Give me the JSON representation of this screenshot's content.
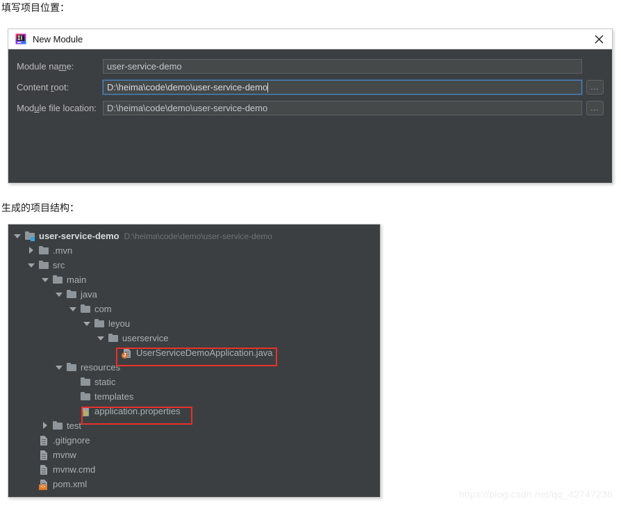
{
  "page": {
    "caption_location": "填写项目位置：",
    "caption_structure": "生成的项目结构：",
    "watermark": "https://blog.csdn.net/qq_42747236"
  },
  "dialog": {
    "title": "New Module",
    "title_icon": "intellij-idea-icon",
    "close_icon": "close-icon",
    "fields": [
      {
        "label_pre": "Module na",
        "label_mnemonic": "m",
        "label_post": "e:",
        "label_full": "Module name:",
        "value": "user-service-demo",
        "focused": false,
        "has_browse": false,
        "browse_label": "..."
      },
      {
        "label_pre": "Content ",
        "label_mnemonic": "r",
        "label_post": "oot:",
        "label_full": "Content root:",
        "value": "D:\\heima\\code\\demo\\user-service-demo",
        "focused": true,
        "has_browse": true,
        "browse_label": "..."
      },
      {
        "label_pre": "Mod",
        "label_mnemonic": "u",
        "label_post": "le file location:",
        "label_full": "Module file location:",
        "value": "D:\\heima\\code\\demo\\user-service-demo",
        "focused": false,
        "has_browse": true,
        "browse_label": "..."
      }
    ]
  },
  "tree": {
    "nodes": [
      {
        "label": "user-service-demo",
        "path": "D:\\heima\\code\\demo\\user-service-demo",
        "depth": 0,
        "twisty": "expanded",
        "icon": "folder-module-icon",
        "root": true,
        "highlighted": false
      },
      {
        "label": ".mvn",
        "path": "",
        "depth": 1,
        "twisty": "collapsed",
        "icon": "folder-icon",
        "root": false,
        "highlighted": false
      },
      {
        "label": "src",
        "path": "",
        "depth": 1,
        "twisty": "expanded",
        "icon": "folder-icon",
        "root": false,
        "highlighted": false
      },
      {
        "label": "main",
        "path": "",
        "depth": 2,
        "twisty": "expanded",
        "icon": "folder-icon",
        "root": false,
        "highlighted": false
      },
      {
        "label": "java",
        "path": "",
        "depth": 3,
        "twisty": "expanded",
        "icon": "folder-icon",
        "root": false,
        "highlighted": false
      },
      {
        "label": "com",
        "path": "",
        "depth": 4,
        "twisty": "expanded",
        "icon": "folder-icon",
        "root": false,
        "highlighted": false
      },
      {
        "label": "leyou",
        "path": "",
        "depth": 5,
        "twisty": "expanded",
        "icon": "folder-icon",
        "root": false,
        "highlighted": false
      },
      {
        "label": "userservice",
        "path": "",
        "depth": 6,
        "twisty": "expanded",
        "icon": "folder-icon",
        "root": false,
        "highlighted": false
      },
      {
        "label": "UserServiceDemoApplication.java",
        "path": "",
        "depth": 7,
        "twisty": "none",
        "icon": "java-file-icon",
        "root": false,
        "highlighted": true
      },
      {
        "label": "resources",
        "path": "",
        "depth": 3,
        "twisty": "expanded",
        "icon": "folder-icon",
        "root": false,
        "highlighted": false
      },
      {
        "label": "static",
        "path": "",
        "depth": 4,
        "twisty": "none",
        "icon": "folder-icon",
        "root": false,
        "highlighted": false
      },
      {
        "label": "templates",
        "path": "",
        "depth": 4,
        "twisty": "none",
        "icon": "folder-icon",
        "root": false,
        "highlighted": false
      },
      {
        "label": "application.properties",
        "path": "",
        "depth": 4,
        "twisty": "none",
        "icon": "properties-file-icon",
        "root": false,
        "highlighted": true
      },
      {
        "label": "test",
        "path": "",
        "depth": 2,
        "twisty": "collapsed",
        "icon": "folder-icon",
        "root": false,
        "highlighted": false
      },
      {
        "label": ".gitignore",
        "path": "",
        "depth": 1,
        "twisty": "none",
        "icon": "file-icon",
        "root": false,
        "highlighted": false
      },
      {
        "label": "mvnw",
        "path": "",
        "depth": 1,
        "twisty": "none",
        "icon": "file-icon",
        "root": false,
        "highlighted": false
      },
      {
        "label": "mvnw.cmd",
        "path": "",
        "depth": 1,
        "twisty": "none",
        "icon": "file-icon",
        "root": false,
        "highlighted": false
      },
      {
        "label": "pom.xml",
        "path": "",
        "depth": 1,
        "twisty": "none",
        "icon": "xml-file-icon",
        "root": false,
        "highlighted": false
      }
    ]
  },
  "colors": {
    "dialog_bg": "#3c3f41",
    "field_bg": "#45494a",
    "focus_border": "#4a88c7",
    "highlight_red": "#e8302a",
    "tree_text": "#a9b0b5",
    "module_badge": "#36a2e0"
  }
}
